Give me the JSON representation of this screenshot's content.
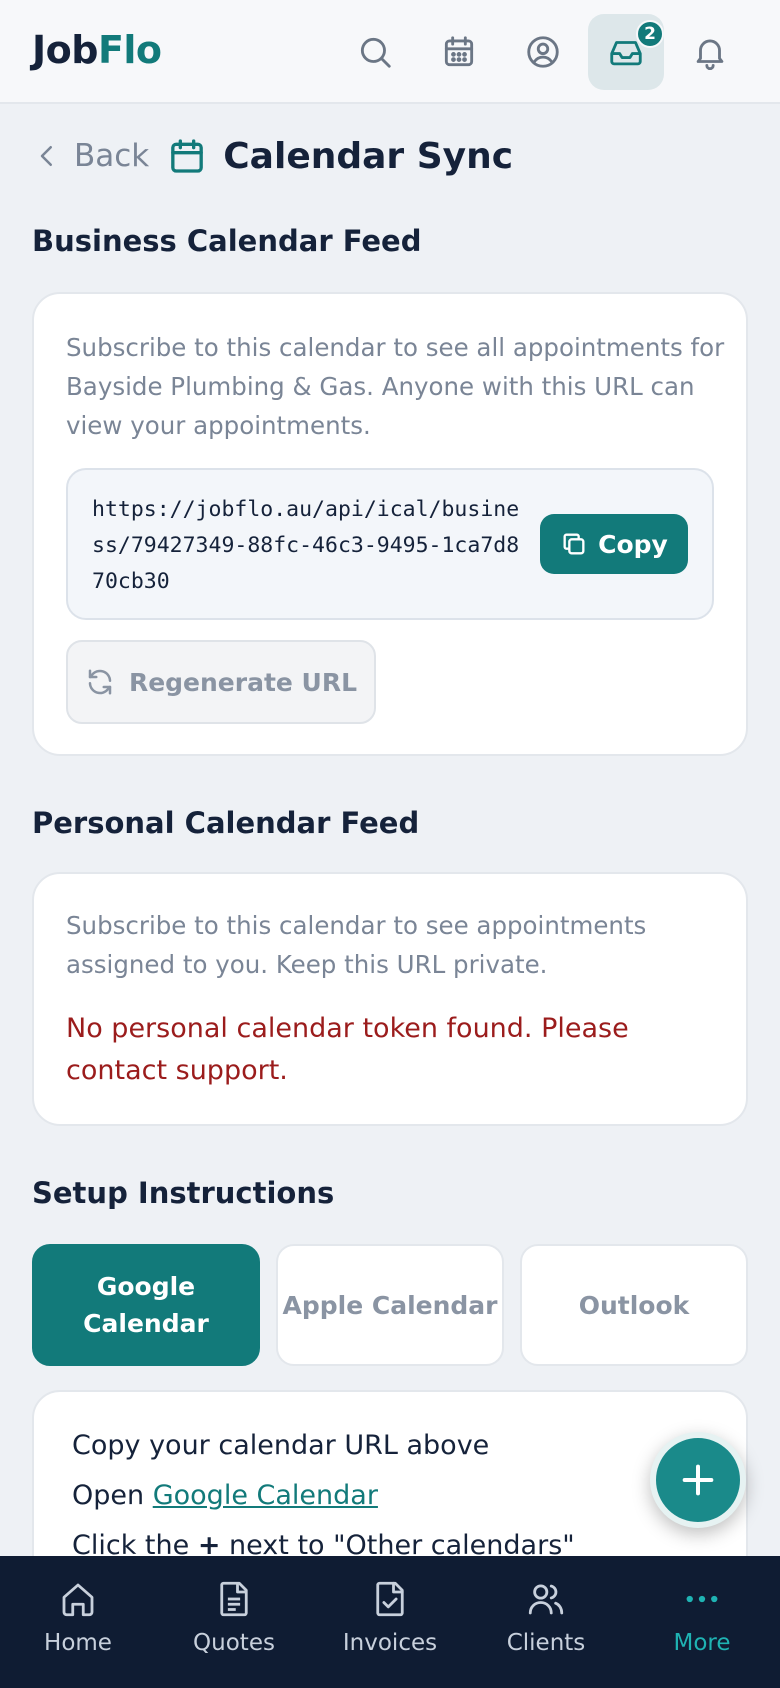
{
  "header": {
    "logo_part1": "Job",
    "logo_part2": "Flo",
    "inbox_badge": "2",
    "icons": [
      "search-icon",
      "calendar-icon",
      "user-circle-icon",
      "inbox-icon",
      "bell-icon"
    ]
  },
  "page": {
    "back_label": "Back",
    "title": "Calendar Sync"
  },
  "business_feed": {
    "heading": "Business Calendar Feed",
    "description": "Subscribe to this calendar to see all appointments for Bayside Plumbing & Gas. Anyone with this URL can view your appointments.",
    "url": "https://jobflo.au/api/ical/business/79427349-88fc-46c3-9495-1ca7d870cb30",
    "copy_label": "Copy",
    "regenerate_label": "Regenerate URL"
  },
  "personal_feed": {
    "heading": "Personal Calendar Feed",
    "description": "Subscribe to this calendar to see appointments assigned to you. Keep this URL private.",
    "error": "No personal calendar token found. Please contact support."
  },
  "setup": {
    "heading": "Setup Instructions",
    "tabs": [
      {
        "label": "Google Calendar",
        "active": true
      },
      {
        "label": "Apple Calendar",
        "active": false
      },
      {
        "label": "Outlook",
        "active": false
      }
    ],
    "step1": "Copy your calendar URL above",
    "step2_prefix": "Open",
    "step2_link": "Google Calendar",
    "step3_prefix": "Click the",
    "step3_plus": "+",
    "step3_suffix": "next to \"Other calendars\""
  },
  "bottom_nav": {
    "items": [
      {
        "label": "Home",
        "icon": "home-icon"
      },
      {
        "label": "Quotes",
        "icon": "document-icon"
      },
      {
        "label": "Invoices",
        "icon": "invoice-check-icon"
      },
      {
        "label": "Clients",
        "icon": "users-icon"
      },
      {
        "label": "More",
        "icon": "more-dots-icon",
        "active": true
      }
    ]
  },
  "colors": {
    "brand": "#127a7a",
    "nav_bg": "#0f1c33",
    "error": "#9b1c1c"
  }
}
